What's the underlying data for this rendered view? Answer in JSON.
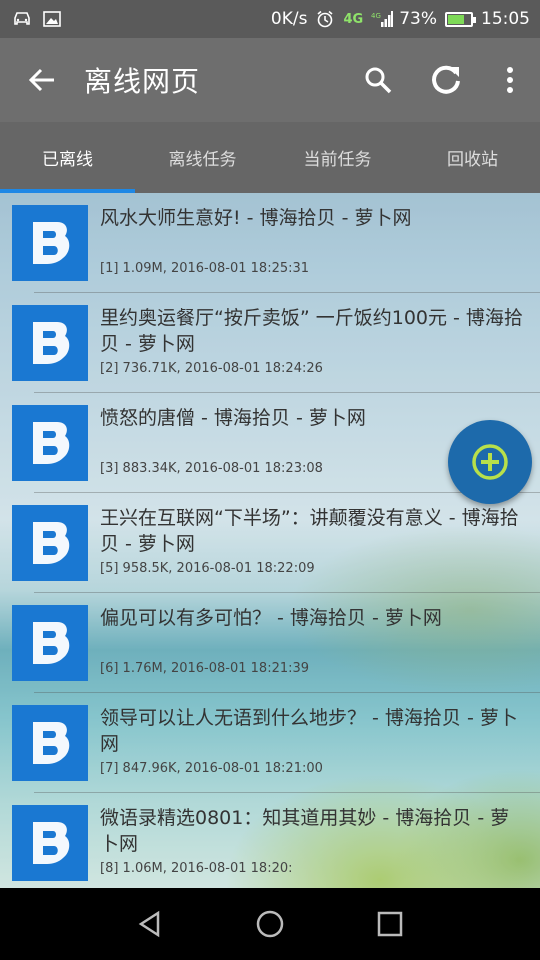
{
  "status_bar": {
    "speed": "0K/s",
    "network": "4G",
    "network2": "4G",
    "battery": "73%",
    "battery_level": 0.73,
    "time": "15:05"
  },
  "app_bar": {
    "title": "离线网页"
  },
  "tabs": [
    {
      "label": "已离线",
      "active": true
    },
    {
      "label": "离线任务",
      "active": false
    },
    {
      "label": "当前任务",
      "active": false
    },
    {
      "label": "回收站",
      "active": false
    }
  ],
  "items": [
    {
      "title": "风水大师生意好! - 博海拾贝 - 萝卜网",
      "meta": "[1] 1.09M, 2016-08-01 18:25:31"
    },
    {
      "title": "里约奥运餐厅“按斤卖饭” 一斤饭约100元 - 博海拾贝 - 萝卜网",
      "meta": "[2] 736.71K, 2016-08-01 18:24:26"
    },
    {
      "title": "愤怒的唐僧 - 博海拾贝 - 萝卜网",
      "meta": "[3] 883.34K, 2016-08-01 18:23:08"
    },
    {
      "title": "王兴在互联网“下半场”：讲颠覆没有意义 - 博海拾贝 - 萝卜网",
      "meta": "[5] 958.5K, 2016-08-01 18:22:09"
    },
    {
      "title": "偏见可以有多可怕？ - 博海拾贝 - 萝卜网",
      "meta": "[6] 1.76M, 2016-08-01 18:21:39"
    },
    {
      "title": "领导可以让人无语到什么地步？ - 博海拾贝 - 萝卜网",
      "meta": "[7] 847.96K, 2016-08-01 18:21:00"
    },
    {
      "title": "微语录精选0801：知其道用其妙 - 博海拾贝 - 萝卜网",
      "meta": "[8] 1.06M, 2016-08-01 18:20:"
    }
  ]
}
